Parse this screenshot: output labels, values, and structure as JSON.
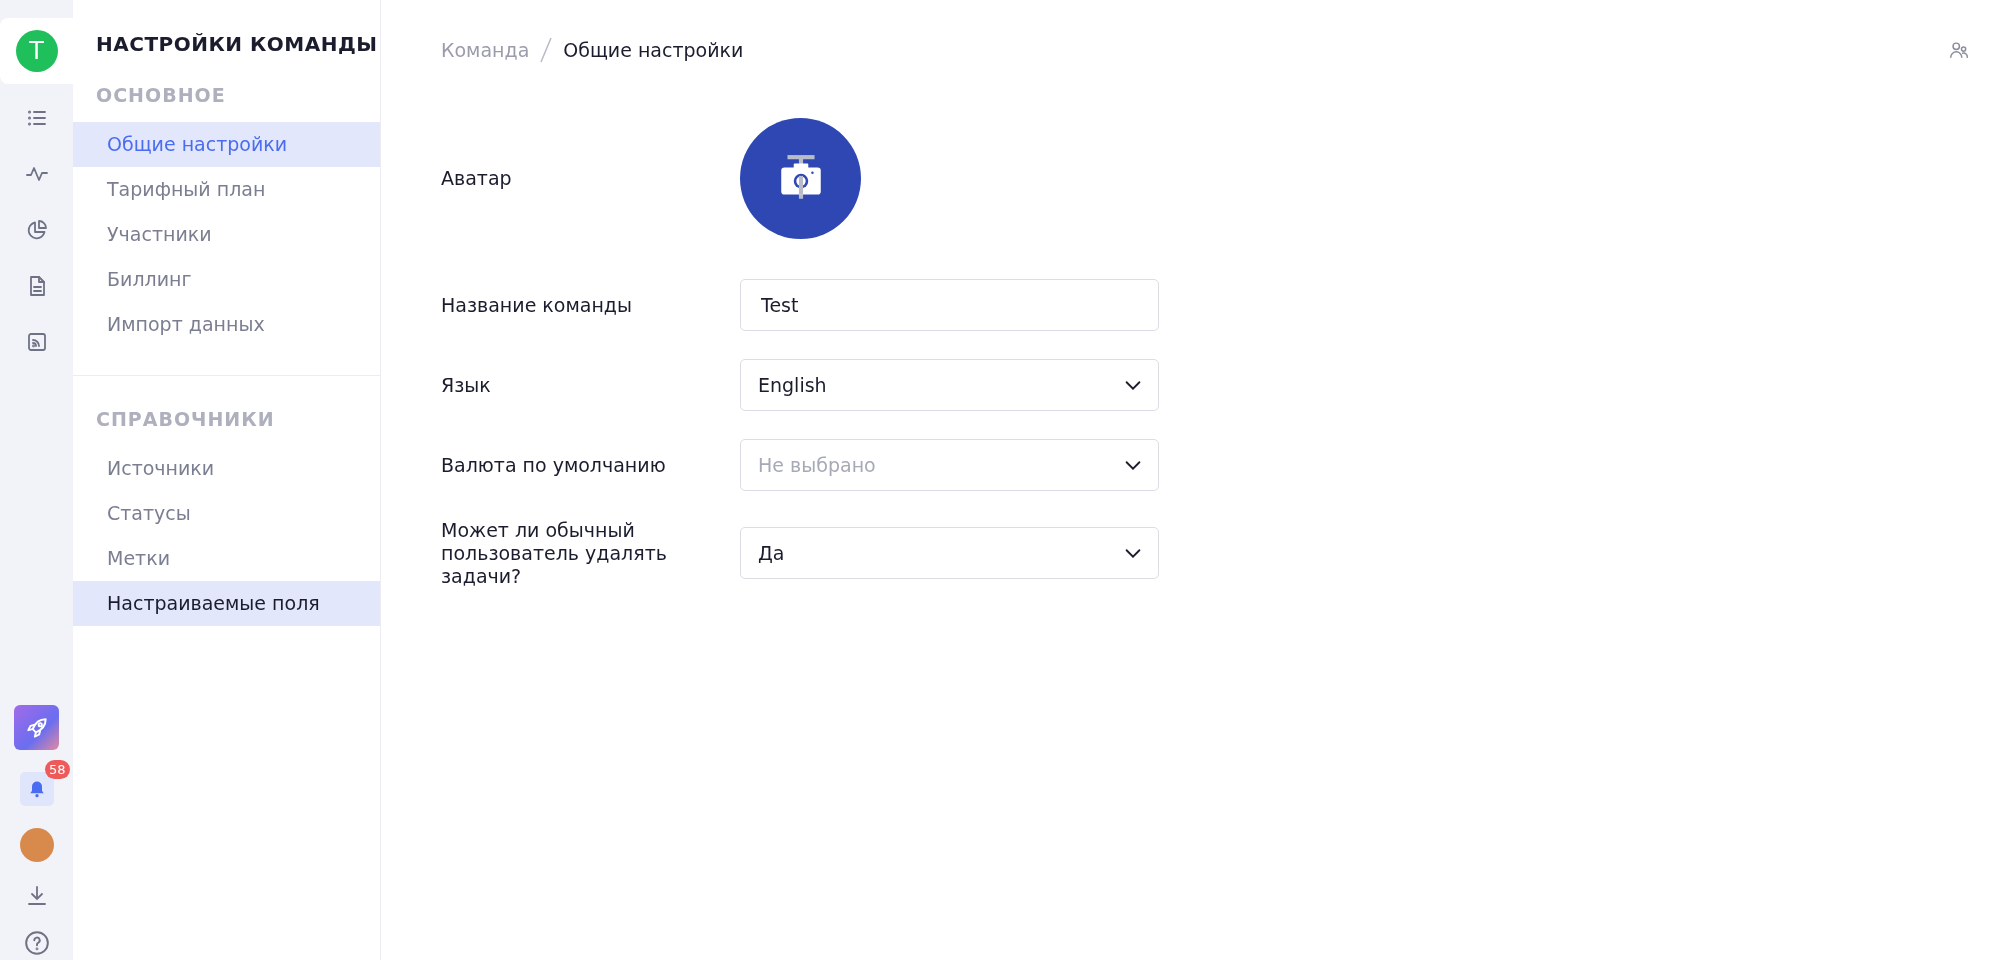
{
  "rail": {
    "team_initial": "T",
    "notifications_count": "58"
  },
  "sidebar": {
    "title": "НАСТРОЙКИ КОМАНДЫ",
    "sections": [
      {
        "heading": "ОСНОВНОЕ",
        "items": [
          {
            "label": "Общие настройки",
            "selected": true,
            "hovered": false
          },
          {
            "label": "Тарифный план",
            "selected": false,
            "hovered": false
          },
          {
            "label": "Участники",
            "selected": false,
            "hovered": false
          },
          {
            "label": "Биллинг",
            "selected": false,
            "hovered": false
          },
          {
            "label": "Импорт данных",
            "selected": false,
            "hovered": false
          }
        ]
      },
      {
        "heading": "СПРАВОЧНИКИ",
        "items": [
          {
            "label": "Источники",
            "selected": false,
            "hovered": false
          },
          {
            "label": "Статусы",
            "selected": false,
            "hovered": false
          },
          {
            "label": "Метки",
            "selected": false,
            "hovered": false
          },
          {
            "label": "Настраиваемые поля",
            "selected": false,
            "hovered": true
          }
        ]
      }
    ]
  },
  "breadcrumb": [
    {
      "label": "Команда"
    },
    {
      "label": "Общие настройки"
    }
  ],
  "form": [
    {
      "kind": "avatar",
      "label": "Аватар"
    },
    {
      "kind": "text",
      "label": "Название команды",
      "value": "Test"
    },
    {
      "kind": "select",
      "label": "Язык",
      "value": "English"
    },
    {
      "kind": "select",
      "label": "Валюта по умолчанию",
      "placeholder": "Не выбрано"
    },
    {
      "kind": "select",
      "label": "Может ли обычный пользователь удалять задачи?",
      "value": "Да"
    }
  ]
}
